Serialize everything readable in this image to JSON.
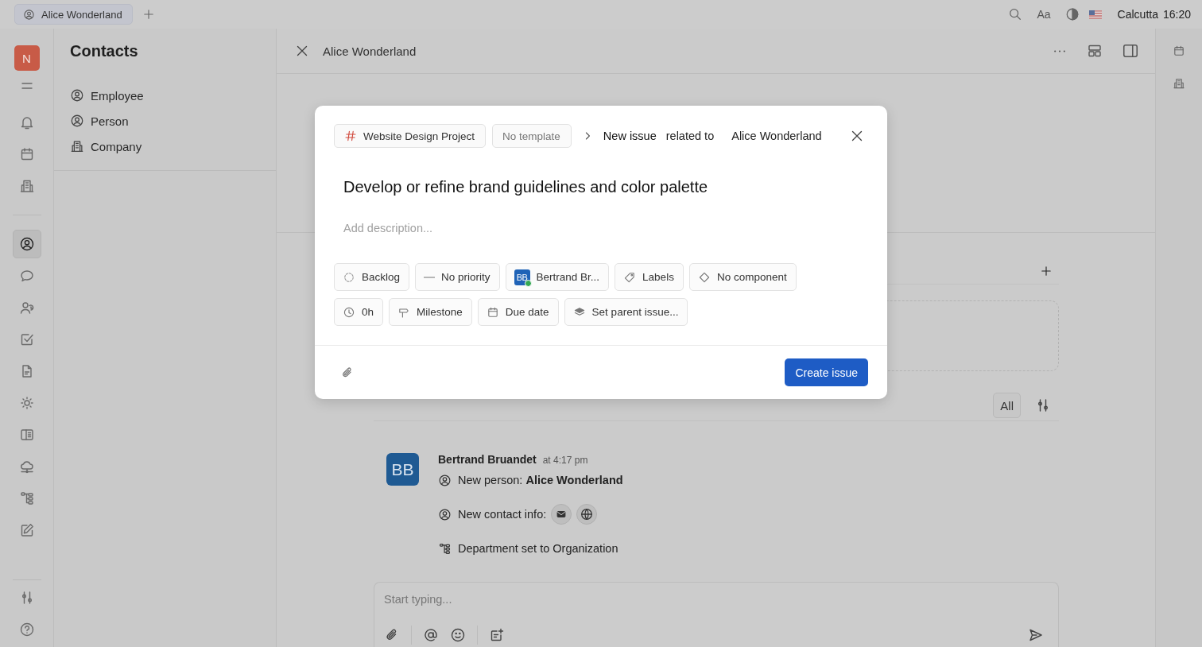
{
  "tabs": [
    {
      "label": "Alice Wonderland",
      "selected": true
    }
  ],
  "top_bar": {
    "font_button": "Aa",
    "region": "Calcutta",
    "time": "16:20"
  },
  "rail": {
    "workspace": "N",
    "items": [
      {
        "selected": false
      },
      {
        "selected": false
      },
      {
        "selected": false
      },
      {
        "selected": true
      },
      {
        "selected": false
      },
      {
        "selected": false
      },
      {
        "selected": false
      },
      {
        "selected": false
      },
      {
        "selected": false
      },
      {
        "selected": false
      },
      {
        "selected": false
      },
      {
        "selected": false
      },
      {
        "selected": false
      }
    ]
  },
  "contacts": {
    "title": "Contacts",
    "items": [
      {
        "label": "Employee",
        "selected": false
      },
      {
        "label": "Person",
        "selected": false
      },
      {
        "label": "Company",
        "selected": false
      }
    ]
  },
  "header": {
    "title": "Alice Wonderland"
  },
  "activity": {
    "filter": "All",
    "avatar": "BB",
    "author": "Bertrand Bruandet",
    "time": "at 4:17 pm",
    "entries": [
      {
        "kind": "person",
        "text": "New person: **Alice Wonderland**"
      },
      {
        "kind": "contact",
        "text": "New contact info:"
      },
      {
        "kind": "department",
        "text": "Department set to Organization"
      }
    ]
  },
  "composer": {
    "placeholder": "Start typing..."
  },
  "dialog": {
    "project": "Website Design Project",
    "template": "No template",
    "crumb": "New issue",
    "related_label": "related to",
    "related": "Alice Wonderland",
    "title": "Develop or refine brand guidelines and color palette",
    "description_placeholder": "Add description...",
    "attributes": [
      {
        "kind": "status",
        "label": "Backlog"
      },
      {
        "kind": "priority",
        "label": "No priority"
      },
      {
        "kind": "assignee",
        "label": "Bertrand Br...",
        "avatar": "BB",
        "online": true
      },
      {
        "kind": "labels",
        "label": "Labels"
      },
      {
        "kind": "component",
        "label": "No component"
      },
      {
        "kind": "estimate",
        "label": "0h"
      },
      {
        "kind": "milestone",
        "label": "Milestone"
      },
      {
        "kind": "due",
        "label": "Due date"
      },
      {
        "kind": "parent",
        "label": "Set parent issue..."
      }
    ],
    "submit": "Create issue"
  }
}
